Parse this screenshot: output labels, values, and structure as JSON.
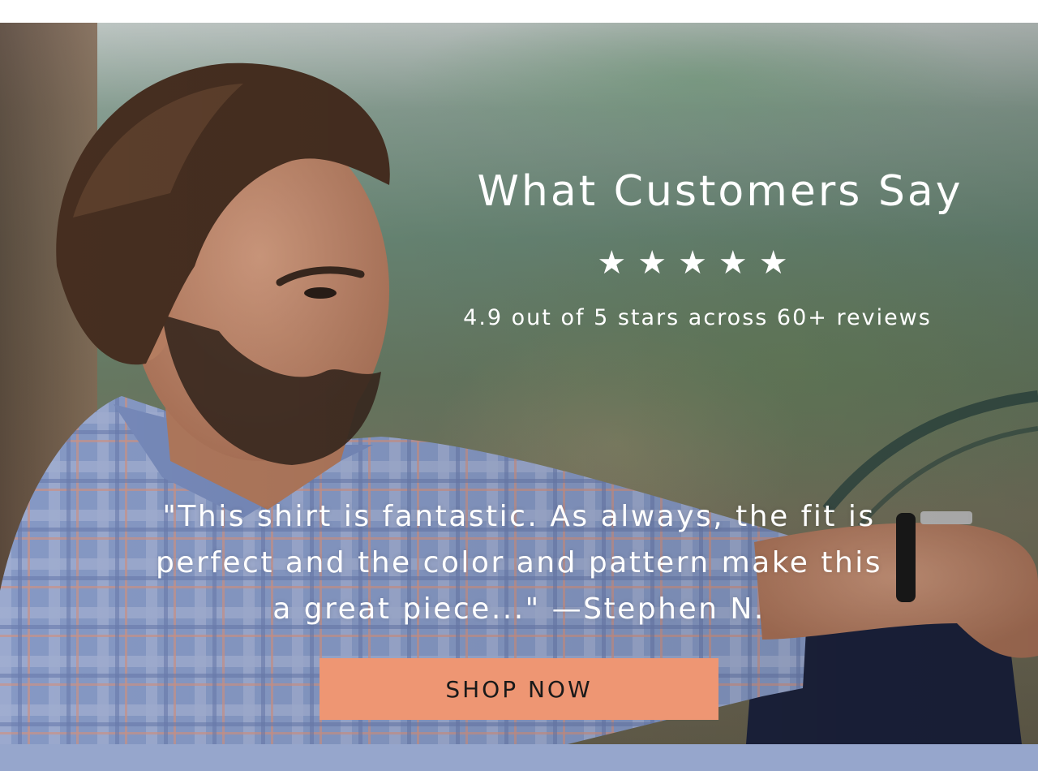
{
  "testimonial_section": {
    "headline": "What Customers Say",
    "rating_value": 5,
    "rating_max": 5,
    "stars": [
      "★",
      "★",
      "★",
      "★",
      "★"
    ],
    "rating_summary": "4.9 out of 5 stars across 60+ reviews",
    "quote_lines": [
      "\"This shirt is fantastic. As always, the fit is",
      "perfect and the color and pattern make this",
      "a great piece...\"  —Stephen N."
    ],
    "cta_label": "SHOP NOW"
  },
  "colors": {
    "cta_background": "#ee9673",
    "bottom_band": "#96a6cc",
    "text": "#ffffff"
  }
}
